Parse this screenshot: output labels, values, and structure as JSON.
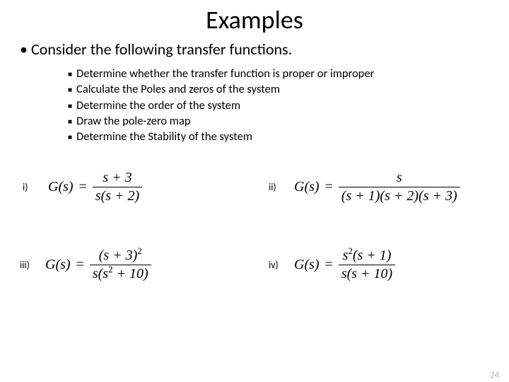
{
  "title": "Examples",
  "main_bullet": "Consider the following transfer functions.",
  "sub_bullets": [
    "Determine whether the transfer function is proper or improper",
    "Calculate the Poles and zeros of the system",
    "Determine the order of the system",
    "Draw the pole-zero map",
    "Determine the Stability of the system"
  ],
  "labels": {
    "i": "i)",
    "ii": "ii)",
    "iii": "iii)",
    "iv": "iv)"
  },
  "lhs": "G(s)",
  "eqs": {
    "i": {
      "num": "s + 3",
      "den": "s(s + 2)"
    },
    "ii": {
      "num": "s",
      "den": "(s + 1)(s + 2)(s + 3)"
    },
    "iii": {
      "num_base": "(s + 3)",
      "num_exp": "2",
      "den_pre": "s(s",
      "den_exp": "2",
      "den_post": " + 10)"
    },
    "iv": {
      "num_pre": "s",
      "num_exp": "2",
      "num_post": "(s + 1)",
      "den": "s(s + 10)"
    }
  },
  "page_number": "24"
}
